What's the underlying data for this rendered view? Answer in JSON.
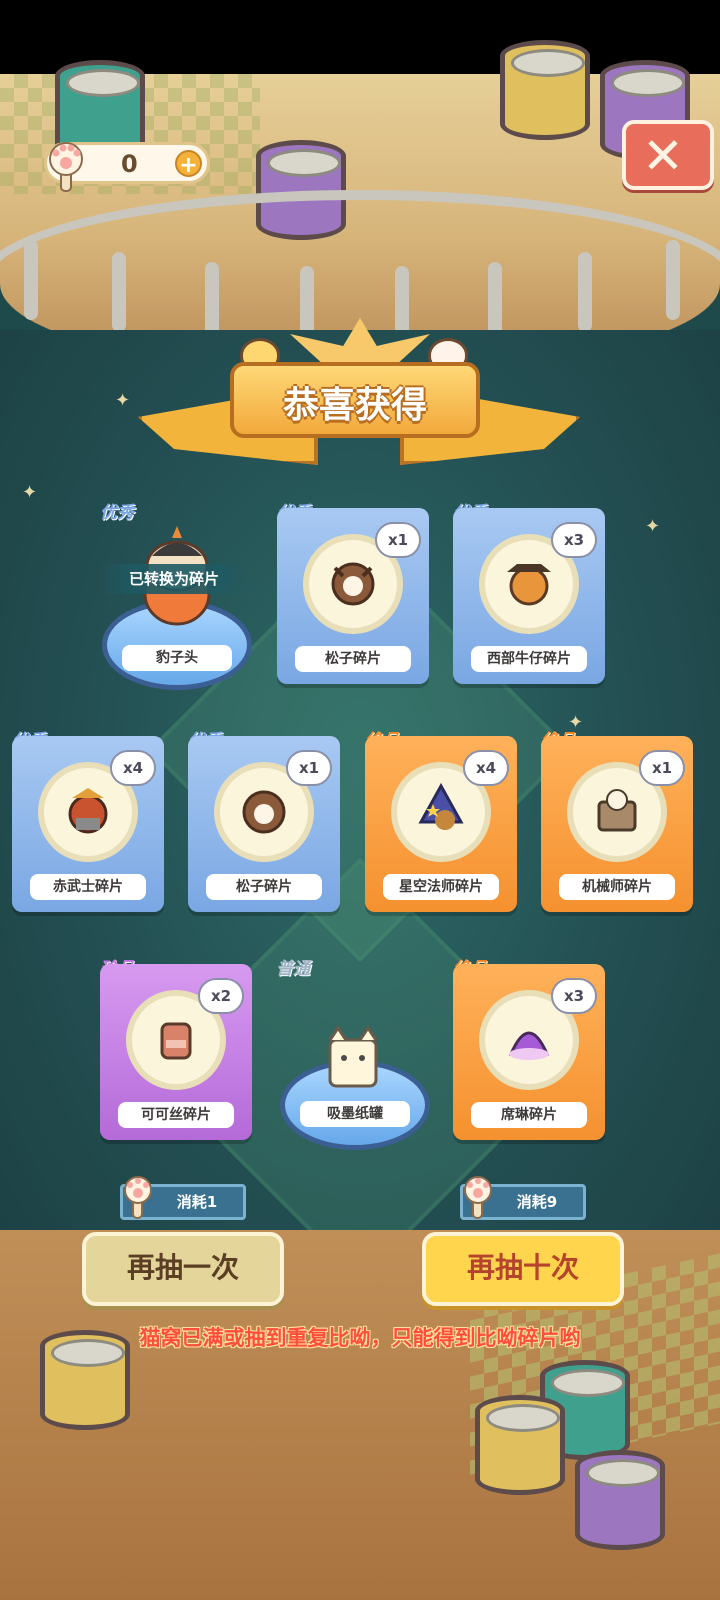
{
  "hud": {
    "currency_value": "0",
    "plus_label": "+",
    "close_label": "✕"
  },
  "banner": {
    "title": "恭喜获得"
  },
  "rewards": [
    {
      "rarity": "优秀",
      "name": "豹子头",
      "status": "已转换为碎片"
    },
    {
      "rarity": "优秀",
      "name": "松子碎片",
      "count": "x1"
    },
    {
      "rarity": "优秀",
      "name": "西部牛仔碎片",
      "count": "x3"
    },
    {
      "rarity": "优秀",
      "name": "赤武士碎片",
      "count": "x4"
    },
    {
      "rarity": "优秀",
      "name": "松子碎片",
      "count": "x1"
    },
    {
      "rarity": "绝品",
      "name": "星空法师碎片",
      "count": "x4"
    },
    {
      "rarity": "绝品",
      "name": "机械师碎片",
      "count": "x1"
    },
    {
      "rarity": "珍品",
      "name": "可可丝碎片",
      "count": "x2"
    },
    {
      "rarity": "普通",
      "name": "吸墨纸罐"
    },
    {
      "rarity": "绝品",
      "name": "席琳碎片",
      "count": "x3"
    }
  ],
  "actions": {
    "draw_once": {
      "label": "再抽一次",
      "cost": "消耗1"
    },
    "draw_ten": {
      "label": "再抽十次",
      "cost": "消耗9"
    }
  },
  "notice": "猫窝已满或抽到重复比呦，只能得到比呦碎片哟",
  "colors": {
    "good": "#7aa4e8",
    "best": "#ff8a2a",
    "rare": "#c874e6",
    "warning": "#ff4e3a"
  }
}
